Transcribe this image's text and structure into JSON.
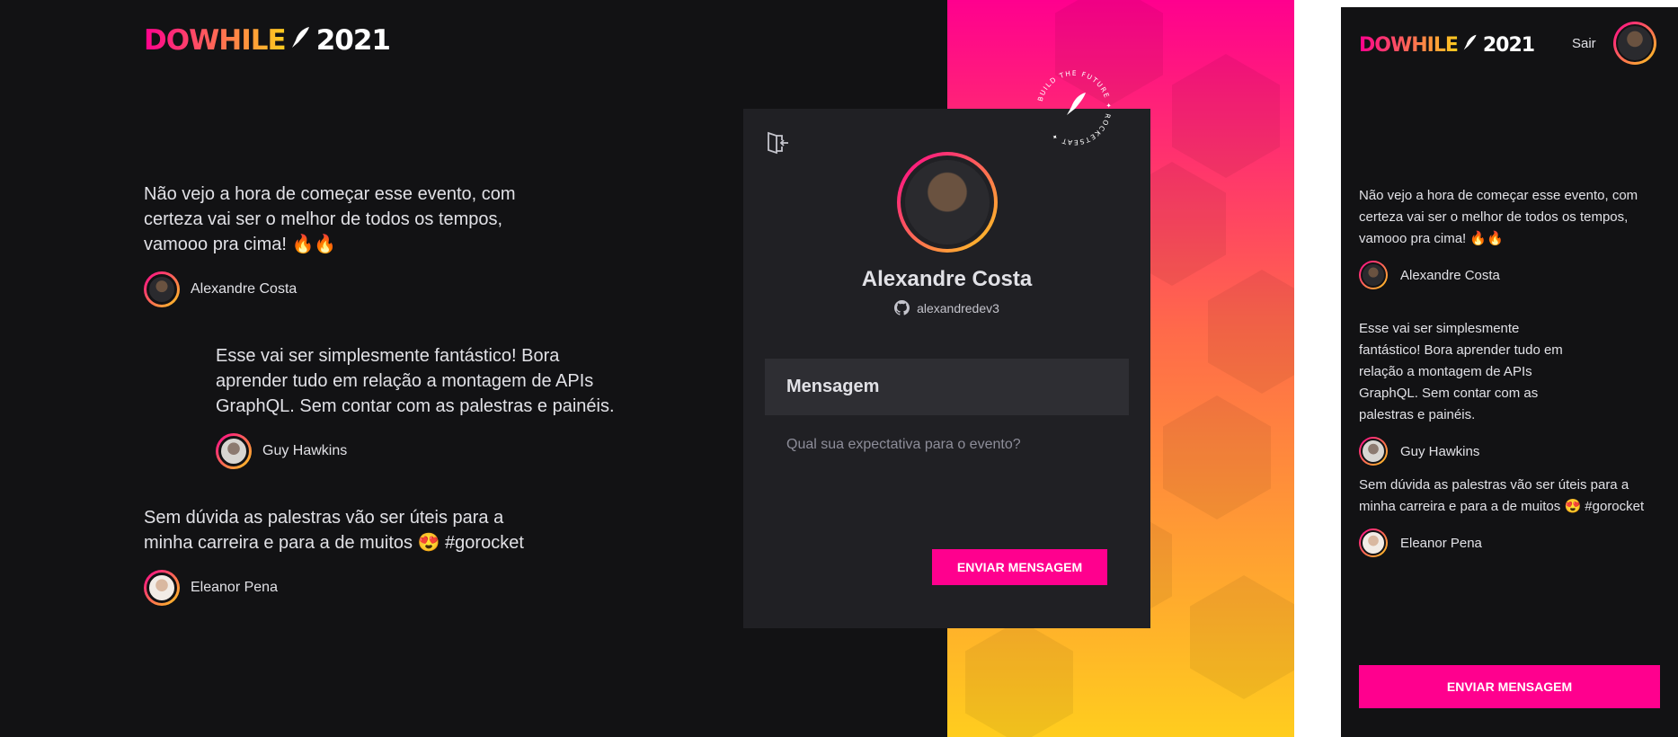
{
  "brand": {
    "logo_part1": "DOWHILE",
    "logo_icon": "rocket-icon",
    "logo_part2": "2021",
    "primary_color": "#ff008e",
    "accent_color": "#ffcd1e",
    "background": "#121214"
  },
  "desktop": {
    "messages": [
      {
        "text": "Não vejo a hora de começar esse evento, com certeza vai ser o melhor de todos os tempos, vamooo pra cima! 🔥🔥",
        "author": "Alexandre Costa"
      },
      {
        "text": "Esse vai ser simplesmente fantástico! Bora aprender tudo em relação a montagem de APIs GraphQL. Sem contar com as palestras e painéis.",
        "author": "Guy Hawkins"
      },
      {
        "text": "Sem dúvida as palestras vão ser úteis para a minha carreira e para a de muitos 😍 #gorocket",
        "author": "Eleanor Pena"
      }
    ],
    "badge": {
      "top_text": "BUILD THE FUTURE",
      "bottom_text": "ROCKETSEAT"
    },
    "card": {
      "user_name": "Alexandre Costa",
      "github_login": "alexandredev3",
      "form_title": "Mensagem",
      "placeholder": "Qual sua expectativa para o evento?",
      "send_label": "Enviar mensagem"
    }
  },
  "mobile": {
    "signout_label": "Sair",
    "messages": [
      {
        "text": "Não vejo a hora de começar esse evento, com certeza vai ser o melhor de todos os tempos, vamooo pra cima! 🔥🔥",
        "author": "Alexandre Costa"
      },
      {
        "text": "Esse vai ser simplesmente fantástico! Bora aprender tudo em relação a montagem de APIs GraphQL. Sem contar com as palestras e painéis.",
        "author": "Guy Hawkins"
      },
      {
        "text": "Sem dúvida as palestras vão ser úteis para a minha carreira e para a de muitos 😍 #gorocket",
        "author": "Eleanor Pena"
      }
    ],
    "send_label": "ENVIAR MENSAGEM"
  }
}
